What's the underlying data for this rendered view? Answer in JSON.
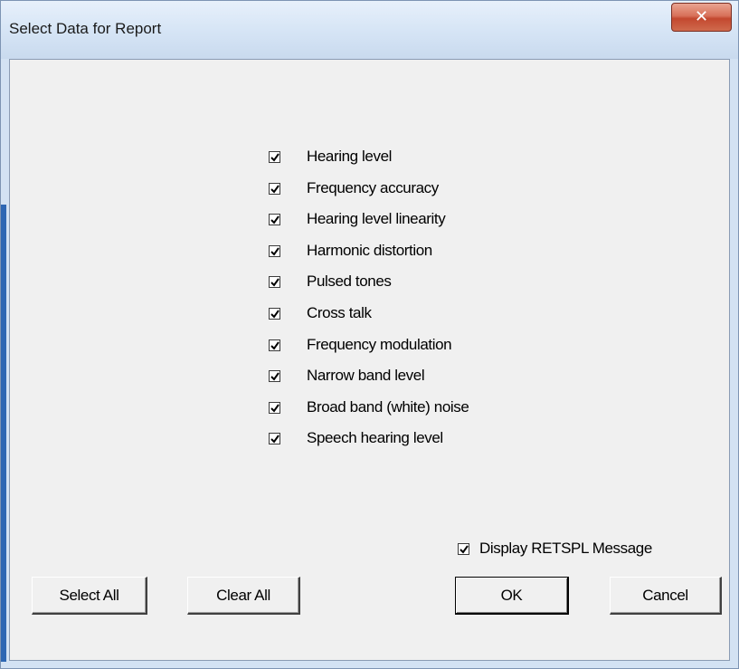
{
  "window": {
    "title": "Select Data for Report",
    "close_icon": "close-icon"
  },
  "checklist": {
    "items": [
      {
        "label": "Hearing level",
        "checked": true
      },
      {
        "label": "Frequency accuracy",
        "checked": true
      },
      {
        "label": "Hearing level linearity",
        "checked": true
      },
      {
        "label": "Harmonic distortion",
        "checked": true
      },
      {
        "label": "Pulsed tones",
        "checked": true
      },
      {
        "label": "Cross talk",
        "checked": true
      },
      {
        "label": "Frequency modulation",
        "checked": true
      },
      {
        "label": "Narrow band level",
        "checked": true
      },
      {
        "label": "Broad band (white) noise",
        "checked": true
      },
      {
        "label": "Speech hearing level",
        "checked": true
      }
    ]
  },
  "options": {
    "retspl_label": "Display RETSPL Message",
    "retspl_checked": true
  },
  "buttons": {
    "select_all": "Select All",
    "clear_all": "Clear All",
    "ok": "OK",
    "cancel": "Cancel"
  },
  "colors": {
    "title_bar": "#d5e4f5",
    "close_button": "#c3482f",
    "client_background": "#f0f0f0"
  }
}
